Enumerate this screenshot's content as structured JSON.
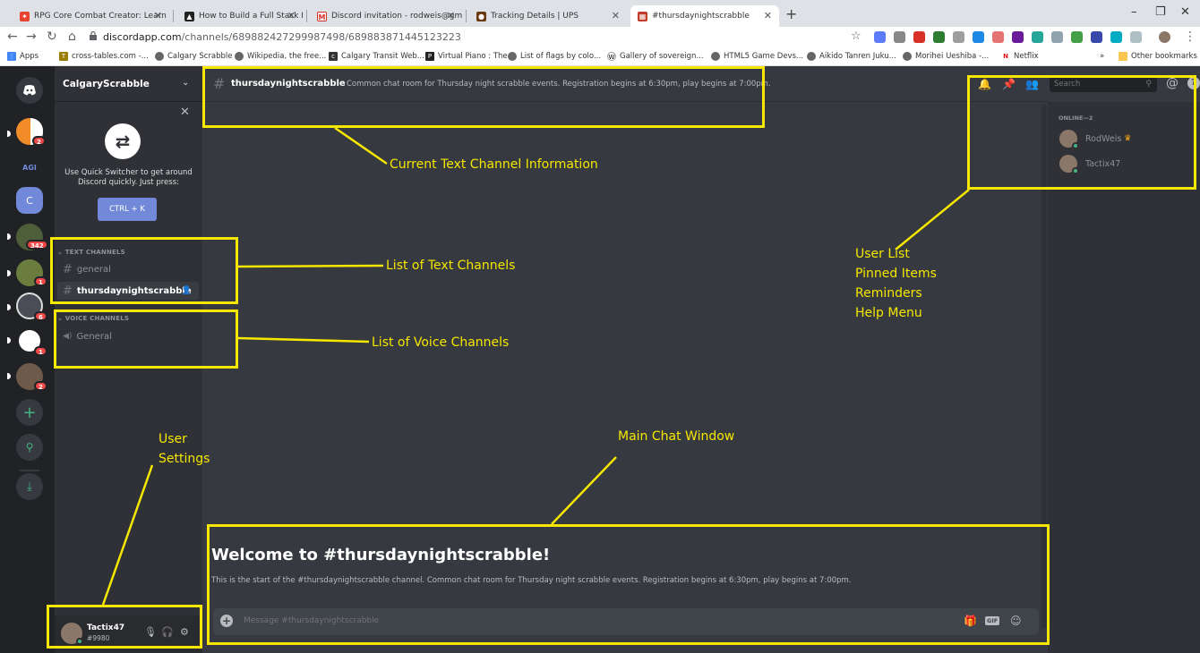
{
  "browser": {
    "tabs": [
      {
        "label": "RPG Core Combat Creator: Learn",
        "icon_color": "#e8432e",
        "icon": "rpg-icon"
      },
      {
        "label": "How to Build a Full Stack RPG Ch",
        "icon_color": "#222222",
        "icon": "udemy-icon"
      },
      {
        "label": "Discord invitation - rodweis@gm",
        "icon_color": "#d93025",
        "icon": "gmail-icon"
      },
      {
        "label": "Tracking Details | UPS",
        "icon_color": "#6b3b10",
        "icon": "ups-icon"
      },
      {
        "label": "#thursdaynightscrabble",
        "icon_color": "#c23a2a",
        "icon": "scrabble-icon"
      }
    ],
    "new_tab": "+",
    "window_controls": [
      "–",
      "❐",
      "✕"
    ],
    "url_host": "discordapp.com",
    "url_path": "/channels/689882427299987498/689883871445123223",
    "bookmarks": [
      "Apps",
      "cross-tables.com -...",
      "Calgary Scrabble",
      "Wikipedia, the free...",
      "Calgary Transit Web...",
      "Virtual Piano : The...",
      "List of flags by colo...",
      "Gallery of sovereign...",
      "HTML5 Game Devs...",
      "Aikido Tanren Juku...",
      "Morihei Ueshiba -...",
      "Netflix"
    ],
    "bookmarks_overflow": "»",
    "other_bookmarks": "Other bookmarks"
  },
  "guilds": {
    "badges": [
      "2",
      "342",
      "1",
      "6",
      "1",
      "2"
    ],
    "text_server": "C",
    "agi_label": "AGI"
  },
  "sidebar": {
    "server_name": "CalgaryScrabble",
    "quick_switcher": {
      "text": "Use Quick Switcher to get around Discord quickly. Just press:",
      "shortcut": "CTRL + K"
    },
    "text_category": "TEXT CHANNELS",
    "text_channels": [
      "general",
      "thursdaynightscrabble"
    ],
    "voice_category": "VOICE CHANNELS",
    "voice_channels": [
      "General"
    ]
  },
  "user": {
    "name": "Tactix47",
    "discriminator": "#9980"
  },
  "channel": {
    "name": "thursdaynightscrabble",
    "topic": "Common chat room for Thursday night scrabble events. Registration begins at 6:30pm, play begins at 7:00pm.",
    "search_placeholder": "Search",
    "welcome_title": "Welcome to #thursdaynightscrabble!",
    "welcome_desc": "This is the start of the #thursdaynightscrabble channel. Common chat room for Thursday night scrabble events. Registration begins at 6:30pm, play begins at 7:00pm.",
    "message_placeholder": "Message #thursdaynightscrabble",
    "gif_label": "GIF"
  },
  "members": {
    "category": "ONLINE—2",
    "list": [
      "RodWeis",
      "Tactix47"
    ]
  },
  "annotations": {
    "channel_info": "Current Text Channel Information",
    "text_channels": "List of Text Channels",
    "voice_channels": "List of Voice Channels",
    "user_list_lines": [
      "User List",
      "Pinned Items",
      "Reminders",
      "Help Menu"
    ],
    "main_chat": "Main Chat Window",
    "user_settings_lines": [
      "User",
      "Settings"
    ],
    "color": "#f5e700"
  }
}
